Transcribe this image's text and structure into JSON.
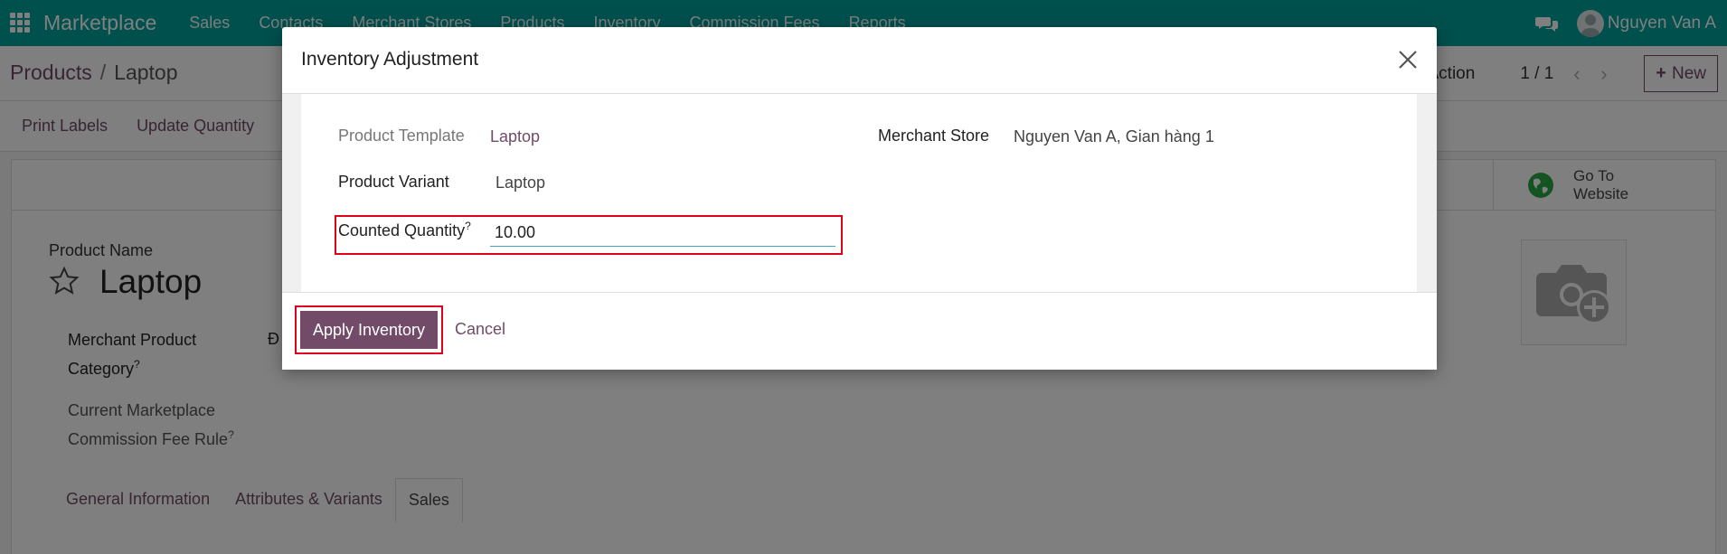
{
  "navbar": {
    "brand": "Marketplace",
    "menu": [
      "Sales",
      "Contacts",
      "Merchant Stores",
      "Products",
      "Inventory",
      "Commission Fees",
      "Reports"
    ],
    "user_name": "Nguyen Van A",
    "color": "#00a09d"
  },
  "control_panel": {
    "breadcrumb_parent": "Products",
    "breadcrumb_separator": "/",
    "breadcrumb_current": "Laptop",
    "action_label": "Action",
    "pager": "1 / 1",
    "new_label": "New"
  },
  "button_bar": {
    "print_labels": "Print Labels",
    "update_quantity": "Update Quantity"
  },
  "form": {
    "go_to_website": "Go To Website",
    "product_name_label": "Product Name",
    "product_name": "Laptop",
    "category_label": "Merchant Product Category",
    "category_value_partial": "Đ",
    "fee_rule_label": "Current Marketplace Commission Fee Rule",
    "help_mark": "?",
    "tabs": [
      "General Information",
      "Attributes & Variants",
      "Sales"
    ],
    "active_tab": "Sales"
  },
  "modal": {
    "title": "Inventory Adjustment",
    "product_template_label": "Product Template",
    "product_template_value": "Laptop",
    "merchant_store_label": "Merchant Store",
    "merchant_store_value": "Nguyen Van A, Gian hàng 1",
    "product_variant_label": "Product Variant",
    "product_variant_value": "Laptop",
    "counted_quantity_label": "Counted Quantity",
    "counted_quantity_value": "10.00",
    "apply_label": "Apply Inventory",
    "cancel_label": "Cancel",
    "accent_color": "#714b67",
    "highlight_color": "#e0001b"
  }
}
